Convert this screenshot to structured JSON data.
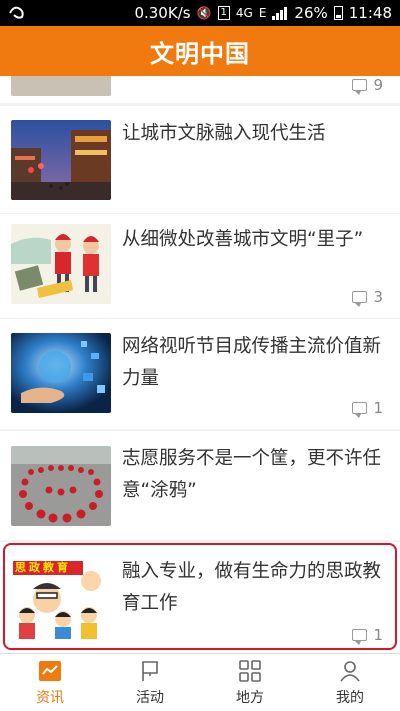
{
  "status_bar": {
    "speed": "0.30K/s",
    "sim": "1",
    "network": "4G",
    "signal_label": "E",
    "battery": "26%",
    "time": "11:48"
  },
  "app_bar": {
    "title": "文明中国"
  },
  "feed": {
    "items": [
      {
        "headline": "",
        "comments": "9"
      },
      {
        "headline": "让城市文脉融入现代生活",
        "comments": ""
      },
      {
        "headline": "从细微处改善城市文明“里子”",
        "comments": "3"
      },
      {
        "headline": "网络视听节目成传播主流价值新力量",
        "comments": "1"
      },
      {
        "headline": "志愿服务不是一个筐，更不许任意“涂鸦”",
        "comments": ""
      },
      {
        "headline": "融入专业，做有生命力的思政教育工作",
        "comments": "1"
      }
    ],
    "item5_thumb_banner": "思政教育"
  },
  "tabs": [
    {
      "label": "资讯",
      "icon": "news-icon",
      "active": true
    },
    {
      "label": "活动",
      "icon": "flag-icon",
      "active": false
    },
    {
      "label": "地方",
      "icon": "grid-icon",
      "active": false
    },
    {
      "label": "我的",
      "icon": "user-icon",
      "active": false
    }
  ],
  "colors": {
    "accent": "#f07a10",
    "highlight": "#d8152a"
  }
}
